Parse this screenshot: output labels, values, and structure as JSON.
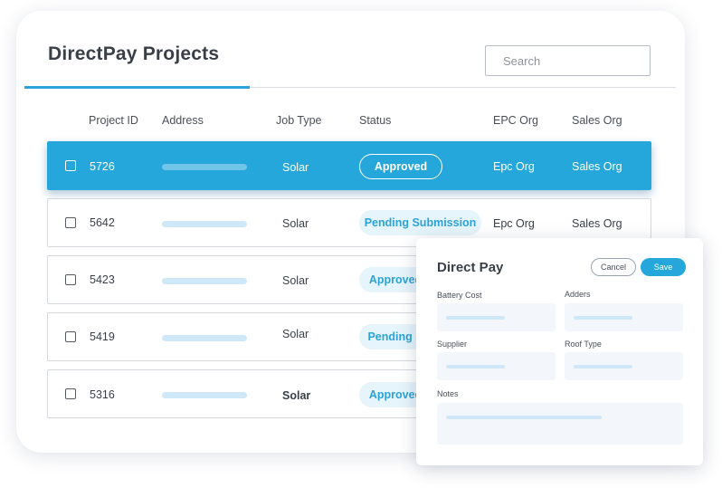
{
  "header": {
    "title": "DirectPay Projects"
  },
  "search": {
    "placeholder": "Search"
  },
  "table": {
    "columns": [
      "Project ID",
      "Address",
      "Job Type",
      "Status",
      "EPC Org",
      "Sales Org"
    ],
    "rows": [
      {
        "id": "5726",
        "job_type": "Solar",
        "status": "Approved",
        "epc_org": "Epc Org",
        "sales_org": "Sales Org",
        "selected": true
      },
      {
        "id": "5642",
        "job_type": "Solar",
        "status": "Pending Submission",
        "epc_org": "Epc Org",
        "sales_org": "Sales Org",
        "selected": false
      },
      {
        "id": "5423",
        "job_type": "Solar",
        "status": "Approved",
        "epc_org": "",
        "sales_org": "",
        "selected": false
      },
      {
        "id": "5419",
        "job_type": "Solar",
        "status": "Pending S",
        "epc_org": "",
        "sales_org": "",
        "selected": false
      },
      {
        "id": "5316",
        "job_type": "Solar",
        "status": "Approved",
        "epc_org": "",
        "sales_org": "",
        "selected": false
      }
    ]
  },
  "panel": {
    "title": "Direct Pay",
    "cancel_label": "Cancel",
    "save_label": "Save",
    "fields": {
      "battery_cost": "Battery Cost",
      "adders": "Adders",
      "supplier": "Supplier",
      "roof_type": "Roof Type",
      "notes": "Notes"
    }
  },
  "colors": {
    "accent": "#25a7dc",
    "pill_bg": "#e6f4fb",
    "placeholder_bar": "#cfe8f7"
  }
}
